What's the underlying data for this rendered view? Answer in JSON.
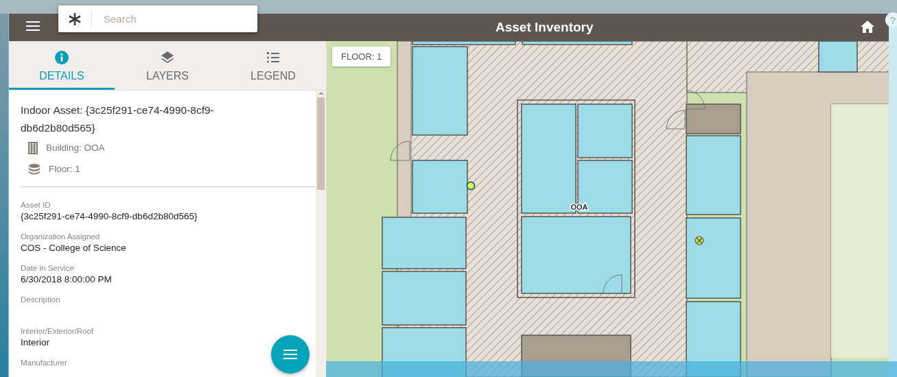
{
  "header": {
    "title": "Asset Inventory"
  },
  "search": {
    "placeholder": "Search"
  },
  "help_button": "?",
  "tabs": [
    {
      "label": "DETAILS",
      "kind": "info",
      "selected": true
    },
    {
      "label": "LAYERS",
      "kind": "layers",
      "selected": false
    },
    {
      "label": "LEGEND",
      "kind": "legend",
      "selected": false
    }
  ],
  "details": {
    "title": "Indoor Asset: {3c25f291-ce74-4990-8cf9-db6d2b80d565}",
    "meta": [
      {
        "kind": "building",
        "text": "Building: OOA"
      },
      {
        "kind": "floor",
        "text": "Floor: 1"
      }
    ],
    "fields": [
      {
        "label": "Asset ID",
        "value": "{3c25f291-ce74-4990-8cf9-db6d2b80d565}"
      },
      {
        "label": "Organization Assigned",
        "value": "COS - College of Science"
      },
      {
        "label": "Date in Service",
        "value": "6/30/2018 8:00:00 PM"
      },
      {
        "label": "Description"
      },
      {
        "label": "Interior/Exterior/Roof",
        "value": "Interior"
      },
      {
        "label": "Manufacturer"
      }
    ]
  },
  "map": {
    "floor_badge": "FLOOR: 1",
    "building_label": "OOA"
  }
}
